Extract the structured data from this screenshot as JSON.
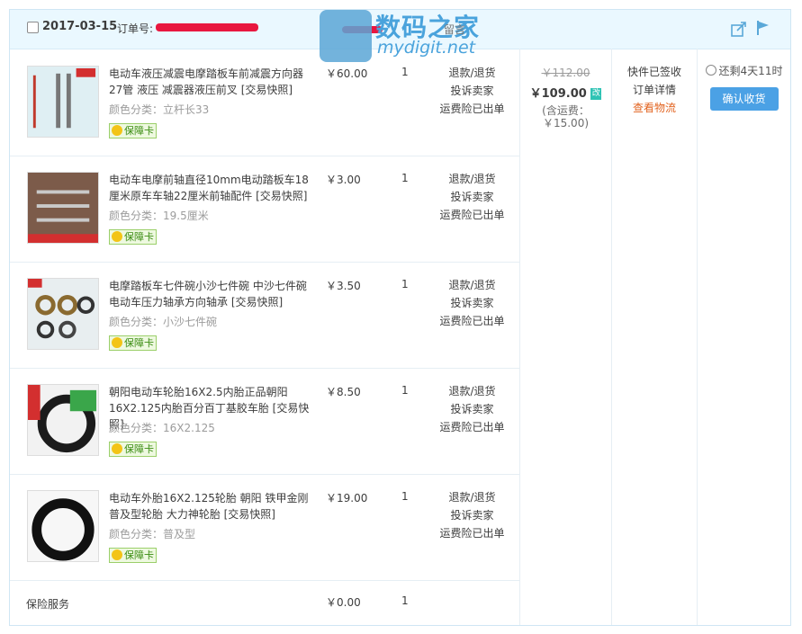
{
  "order": {
    "date": "2017-03-15",
    "order_label": "订单号:",
    "message_label": "留言"
  },
  "watermark": {
    "title": "数码之家",
    "subtitle": "mydigit.net"
  },
  "items": [
    {
      "name": "电动车液压减震电摩踏板车前减震方向器27管 液压 减震器液压前叉 [交易快照]",
      "color": "颜色分类：立杆长33",
      "badge": "保障卡",
      "price": "￥60.00",
      "qty": "1",
      "ops": [
        "退款/退货",
        "投诉卖家",
        "运费险已出单"
      ]
    },
    {
      "name": "电动车电摩前轴直径10mm电动踏板车18厘米原车车轴22厘米前轴配件 [交易快照]",
      "color": "颜色分类：19.5厘米",
      "badge": "保障卡",
      "price": "￥3.00",
      "qty": "1",
      "ops": [
        "退款/退货",
        "投诉卖家",
        "运费险已出单"
      ]
    },
    {
      "name": "电摩踏板车七件碗小沙七件碗 中沙七件碗电动车压力轴承方向轴承 [交易快照]",
      "color": "颜色分类：小沙七件碗",
      "badge": "保障卡",
      "price": "￥3.50",
      "qty": "1",
      "ops": [
        "退款/退货",
        "投诉卖家",
        "运费险已出单"
      ]
    },
    {
      "name": "朝阳电动车轮胎16X2.5内胎正品朝阳16X2.125内胎百分百丁基胶车胎 [交易快照]",
      "color": "颜色分类：16X2.125",
      "badge": "保障卡",
      "price": "￥8.50",
      "qty": "1",
      "ops": [
        "退款/退货",
        "投诉卖家",
        "运费险已出单"
      ]
    },
    {
      "name": "电动车外胎16X2.125轮胎 朝阳 铁甲金刚 普及型轮胎 大力神轮胎 [交易快照]",
      "color": "颜色分类：普及型",
      "badge": "保障卡",
      "price": "￥19.00",
      "qty": "1",
      "ops": [
        "退款/退货",
        "投诉卖家",
        "运费险已出单"
      ]
    }
  ],
  "insurance": {
    "label": "保险服务",
    "price": "￥0.00",
    "qty": "1"
  },
  "total": {
    "original": "￥112.00",
    "actual": "￥109.00",
    "changed_mark": "改",
    "shipping_line1": "(含运费：",
    "shipping_line2": "￥15.00)"
  },
  "status": {
    "line1": "快件已签收",
    "line2": "订单详情",
    "line3": "查看物流"
  },
  "action": {
    "remaining": "还剩4天11时",
    "confirm_label": "确认收货"
  }
}
